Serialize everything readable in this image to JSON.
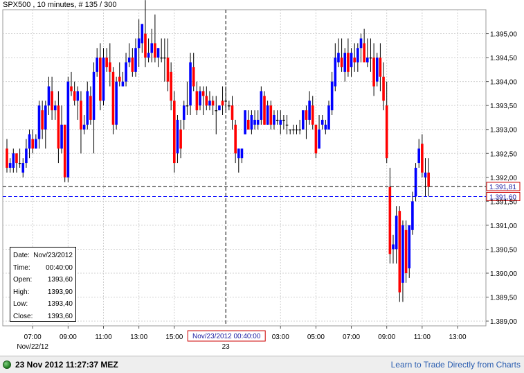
{
  "header": {
    "title": "SPX500 , 10 minutes, # 135 / 300"
  },
  "chart_data": {
    "type": "candlestick",
    "symbol": "SPX500",
    "interval": "10 minutes",
    "ylim": [
      1388.9,
      1395.5
    ],
    "y_ticks": [
      "1.395,00",
      "1.394,50",
      "1.394,00",
      "1.393,50",
      "1.393,00",
      "1.392,50",
      "1.392,00",
      "1.391,50",
      "1.391,00",
      "1.390,50",
      "1.390,00",
      "1.389,50",
      "1.389,00"
    ],
    "y_tick_values": [
      1395.0,
      1394.5,
      1394.0,
      1393.5,
      1393.0,
      1392.5,
      1392.0,
      1391.5,
      1391.0,
      1390.5,
      1390.0,
      1389.5,
      1389.0
    ],
    "x_ticks": [
      "07:00",
      "09:00",
      "11:00",
      "13:00",
      "15:00",
      "03:00",
      "05:00",
      "07:00",
      "09:00",
      "11:00",
      "13:00"
    ],
    "x_tick_bars": [
      8,
      19,
      30,
      41,
      52,
      85,
      96,
      107,
      118,
      129,
      140
    ],
    "x_date_labels": [
      {
        "text": "Nov/22/12",
        "bar": 8
      },
      {
        "text": "23",
        "bar": 68
      }
    ],
    "price_lines": [
      {
        "value": 1391.81,
        "label": "1.391,81",
        "color": "#000000"
      },
      {
        "value": 1391.6,
        "label": "1.391,60",
        "color": "#0000ff"
      }
    ],
    "crosshair": {
      "bar": 68,
      "label": "Nov/23/2012 00:40:00"
    },
    "colors": {
      "up": "#0000ff",
      "down": "#ff0000",
      "neutral": "#000000",
      "label_box": "#cc0000"
    },
    "candles": [
      [
        1392.6,
        1392.8,
        1392.1,
        1392.2
      ],
      [
        1392.2,
        1392.4,
        1392.1,
        1392.3
      ],
      [
        1392.2,
        1392.6,
        1392.1,
        1392.5
      ],
      [
        1392.5,
        1392.5,
        1392.1,
        1392.3
      ],
      [
        1392.3,
        1392.6,
        1392.2,
        1392.3
      ],
      [
        1392.1,
        1392.4,
        1392.0,
        1392.3
      ],
      [
        1392.3,
        1392.8,
        1392.2,
        1392.6
      ],
      [
        1392.6,
        1393.0,
        1392.4,
        1392.9
      ],
      [
        1392.8,
        1393.0,
        1392.5,
        1392.6
      ],
      [
        1392.6,
        1392.9,
        1392.6,
        1392.8
      ],
      [
        1392.8,
        1393.6,
        1392.6,
        1393.5
      ],
      [
        1393.4,
        1393.6,
        1392.8,
        1393.0
      ],
      [
        1393.0,
        1393.6,
        1392.6,
        1393.5
      ],
      [
        1393.5,
        1394.1,
        1393.3,
        1393.9
      ],
      [
        1393.8,
        1394.1,
        1393.2,
        1393.4
      ],
      [
        1393.4,
        1393.6,
        1393.2,
        1393.5
      ],
      [
        1393.5,
        1393.8,
        1392.3,
        1392.6
      ],
      [
        1392.6,
        1393.5,
        1392.5,
        1393.1
      ],
      [
        1393.1,
        1393.1,
        1391.9,
        1392.0
      ],
      [
        1392.0,
        1394.1,
        1391.9,
        1394.0
      ],
      [
        1393.9,
        1394.2,
        1393.7,
        1393.8
      ],
      [
        1393.8,
        1394.0,
        1393.5,
        1393.6
      ],
      [
        1393.6,
        1393.9,
        1393.2,
        1393.8
      ],
      [
        1393.6,
        1393.8,
        1392.5,
        1393.0
      ],
      [
        1393.0,
        1393.3,
        1392.9,
        1393.1
      ],
      [
        1393.1,
        1394.0,
        1393.0,
        1393.8
      ],
      [
        1393.7,
        1393.9,
        1393.1,
        1393.2
      ],
      [
        1393.2,
        1394.4,
        1392.5,
        1394.2
      ],
      [
        1394.2,
        1394.7,
        1394.1,
        1394.5
      ],
      [
        1394.5,
        1394.8,
        1393.4,
        1393.6
      ],
      [
        1393.6,
        1394.7,
        1393.5,
        1394.5
      ],
      [
        1394.5,
        1394.7,
        1394.2,
        1394.3
      ],
      [
        1394.4,
        1394.8,
        1393.9,
        1394.2
      ],
      [
        1394.2,
        1394.3,
        1392.9,
        1393.1
      ],
      [
        1393.1,
        1394.1,
        1393.0,
        1394.0
      ],
      [
        1394.1,
        1394.4,
        1393.9,
        1394.0
      ],
      [
        1393.9,
        1394.2,
        1393.9,
        1394.0
      ],
      [
        1394.0,
        1394.6,
        1393.9,
        1394.4
      ],
      [
        1394.4,
        1394.8,
        1394.3,
        1394.5
      ],
      [
        1394.5,
        1394.7,
        1394.1,
        1394.2
      ],
      [
        1394.2,
        1394.9,
        1394.1,
        1394.7
      ],
      [
        1394.7,
        1395.3,
        1394.3,
        1394.9
      ],
      [
        1394.8,
        1395.2,
        1394.6,
        1395.2
      ],
      [
        1395.0,
        1395.7,
        1394.3,
        1394.5
      ],
      [
        1394.5,
        1394.9,
        1394.4,
        1394.6
      ],
      [
        1394.6,
        1395.1,
        1394.4,
        1394.8
      ],
      [
        1394.8,
        1395.4,
        1394.4,
        1394.5
      ],
      [
        1394.5,
        1394.7,
        1394.3,
        1394.7
      ],
      [
        1394.5,
        1394.9,
        1394.4,
        1394.5
      ],
      [
        1394.5,
        1394.9,
        1394.0,
        1394.5
      ],
      [
        1394.5,
        1394.9,
        1393.8,
        1394.0
      ],
      [
        1394.2,
        1394.4,
        1393.4,
        1393.6
      ],
      [
        1393.6,
        1393.8,
        1392.1,
        1392.3
      ],
      [
        1392.5,
        1393.3,
        1392.3,
        1393.2
      ],
      [
        1393.0,
        1393.2,
        1392.4,
        1392.6
      ],
      [
        1393.2,
        1393.6,
        1393.0,
        1393.5
      ],
      [
        1393.5,
        1394.0,
        1393.3,
        1393.5
      ],
      [
        1393.5,
        1394.6,
        1393.3,
        1394.4
      ],
      [
        1394.3,
        1394.6,
        1393.8,
        1393.9
      ],
      [
        1393.8,
        1394.0,
        1393.3,
        1393.4
      ],
      [
        1393.5,
        1393.9,
        1393.4,
        1393.8
      ],
      [
        1393.8,
        1393.9,
        1393.3,
        1393.7
      ],
      [
        1393.7,
        1393.9,
        1393.4,
        1393.5
      ],
      [
        1393.5,
        1393.8,
        1393.4,
        1393.6
      ],
      [
        1393.6,
        1393.7,
        1393.3,
        1393.5
      ],
      [
        1393.4,
        1393.7,
        1392.9,
        1393.4
      ],
      [
        1393.4,
        1393.5,
        1393.4,
        1393.5
      ],
      [
        1393.6,
        1393.9,
        1393.3,
        1393.5
      ],
      [
        1393.6,
        1393.9,
        1393.4,
        1393.6
      ],
      [
        1393.5,
        1393.6,
        1393.4,
        1393.5
      ],
      [
        1393.5,
        1393.7,
        1393.0,
        1393.2
      ],
      [
        1393.1,
        1393.2,
        1392.3,
        1392.5
      ],
      [
        1392.4,
        1392.6,
        1392.1,
        1392.6
      ],
      [
        1392.4,
        1392.6,
        1392.3,
        1392.6
      ],
      [
        1392.9,
        1393.4,
        1392.9,
        1393.4
      ],
      [
        1393.2,
        1393.4,
        1393.0,
        1393.0
      ],
      [
        1393.0,
        1393.4,
        1392.9,
        1393.3
      ],
      [
        1393.1,
        1393.4,
        1393.0,
        1393.2
      ],
      [
        1393.1,
        1393.4,
        1393.0,
        1393.2
      ],
      [
        1393.2,
        1393.9,
        1393.1,
        1393.8
      ],
      [
        1393.7,
        1393.8,
        1393.1,
        1393.1
      ],
      [
        1393.1,
        1393.6,
        1393.1,
        1393.5
      ],
      [
        1393.5,
        1393.6,
        1393.0,
        1393.1
      ],
      [
        1393.1,
        1393.4,
        1393.0,
        1393.3
      ],
      [
        1393.2,
        1393.4,
        1393.1,
        1393.2
      ],
      [
        1393.1,
        1393.4,
        1392.9,
        1393.2
      ],
      [
        1393.2,
        1393.3,
        1393.0,
        1393.2
      ],
      [
        1393.1,
        1393.3,
        1392.9,
        1393.1
      ],
      [
        1393.0,
        1393.0,
        1392.9,
        1393.0
      ],
      [
        1393.0,
        1393.1,
        1392.9,
        1393.0
      ],
      [
        1393.0,
        1393.1,
        1392.9,
        1393.0
      ],
      [
        1393.0,
        1393.2,
        1392.9,
        1393.0
      ],
      [
        1393.0,
        1393.4,
        1393.0,
        1393.4
      ],
      [
        1393.4,
        1393.5,
        1392.8,
        1393.2
      ],
      [
        1393.2,
        1393.8,
        1393.1,
        1393.6
      ],
      [
        1393.5,
        1393.7,
        1393.0,
        1393.1
      ],
      [
        1393.1,
        1393.1,
        1392.4,
        1392.5
      ],
      [
        1392.6,
        1393.3,
        1392.6,
        1393.0
      ],
      [
        1393.1,
        1393.3,
        1393.0,
        1393.2
      ],
      [
        1393.0,
        1393.2,
        1392.9,
        1393.1
      ],
      [
        1393.0,
        1393.6,
        1393.0,
        1393.5
      ],
      [
        1393.4,
        1394.2,
        1393.3,
        1394.0
      ],
      [
        1393.9,
        1394.8,
        1393.8,
        1394.5
      ],
      [
        1394.4,
        1394.9,
        1394.3,
        1394.6
      ],
      [
        1394.5,
        1394.9,
        1394.2,
        1394.3
      ],
      [
        1394.2,
        1394.7,
        1394.0,
        1394.6
      ],
      [
        1394.6,
        1394.9,
        1394.1,
        1394.2
      ],
      [
        1394.3,
        1394.7,
        1394.1,
        1394.6
      ],
      [
        1394.5,
        1394.8,
        1394.2,
        1394.4
      ],
      [
        1394.4,
        1394.8,
        1394.2,
        1394.7
      ],
      [
        1394.7,
        1395.0,
        1394.4,
        1394.9
      ],
      [
        1394.8,
        1395.1,
        1394.4,
        1394.4
      ],
      [
        1394.4,
        1394.9,
        1394.3,
        1394.5
      ],
      [
        1394.5,
        1394.9,
        1394.2,
        1394.5
      ],
      [
        1394.5,
        1394.8,
        1393.7,
        1393.9
      ],
      [
        1394.0,
        1394.6,
        1393.9,
        1394.5
      ],
      [
        1394.5,
        1394.8,
        1393.8,
        1394.1
      ],
      [
        1394.1,
        1394.4,
        1393.4,
        1393.6
      ],
      [
        1393.5,
        1394.0,
        1392.3,
        1392.4
      ],
      [
        1391.8,
        1392.2,
        1390.2,
        1390.4
      ],
      [
        1390.5,
        1390.8,
        1390.2,
        1390.6
      ],
      [
        1390.5,
        1391.4,
        1390.2,
        1391.2
      ],
      [
        1391.3,
        1391.4,
        1389.4,
        1389.6
      ],
      [
        1389.8,
        1391.1,
        1389.4,
        1391.0
      ],
      [
        1390.9,
        1391.1,
        1389.8,
        1390.0
      ],
      [
        1390.1,
        1391.0,
        1389.9,
        1391.0
      ],
      [
        1390.9,
        1391.7,
        1390.8,
        1391.5
      ],
      [
        1391.6,
        1392.3,
        1391.5,
        1392.2
      ],
      [
        1392.3,
        1392.8,
        1392.2,
        1392.6
      ],
      [
        1392.7,
        1392.9,
        1392.0,
        1392.1
      ],
      [
        1392.0,
        1392.4,
        1391.6,
        1392.1
      ],
      [
        1392.1,
        1392.4,
        1391.6,
        1391.8
      ]
    ],
    "info": {
      "date_label": "Date:",
      "date": "Nov/23/2012",
      "time_label": "Time:",
      "time": "00:40:00",
      "open_label": "Open:",
      "open": "1393,60",
      "high_label": "High:",
      "high": "1393,90",
      "low_label": "Low:",
      "low": "1393,40",
      "close_label": "Close:",
      "close": "1393,60"
    }
  },
  "status_bar": {
    "datetime": "23 Nov 2012 11:27:37 MEZ",
    "link": "Learn to Trade Directly from Charts",
    "indicator_color": "#2e8b2e"
  }
}
